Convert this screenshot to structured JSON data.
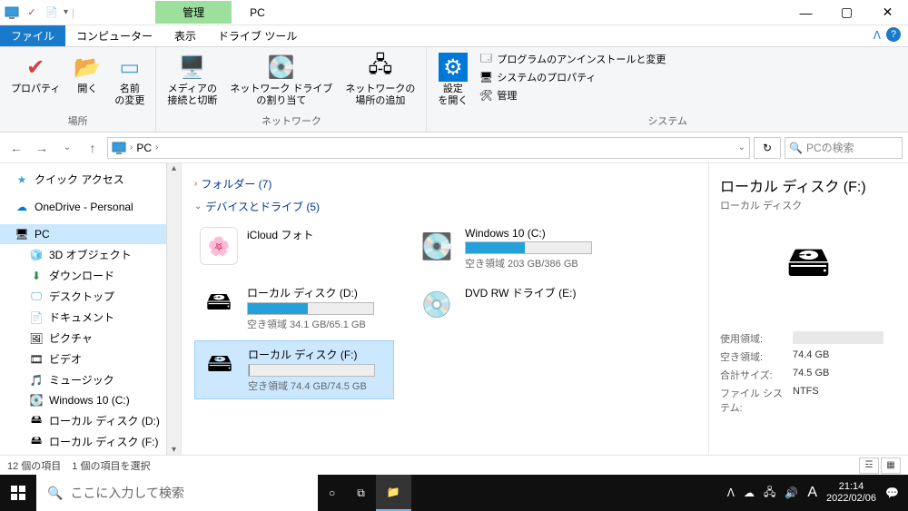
{
  "titlebar": {
    "contextual_tab": "管理",
    "title": "PC"
  },
  "ribbon_tabs": {
    "file": "ファイル",
    "computer": "コンピューター",
    "view": "表示",
    "drive_tools": "ドライブ ツール"
  },
  "ribbon": {
    "location": {
      "properties": "プロパティ",
      "open": "開く",
      "rename": "名前\nの変更",
      "group": "場所"
    },
    "network": {
      "media": "メディアの\n接続と切断",
      "map_drive": "ネットワーク ドライブ\nの割り当て",
      "add_location": "ネットワークの\n場所の追加",
      "group": "ネットワーク"
    },
    "system": {
      "settings": "設定\nを開く",
      "uninstall": "プログラムのアンインストールと変更",
      "sys_props": "システムのプロパティ",
      "manage": "管理",
      "group": "システム"
    }
  },
  "breadcrumb": {
    "root": "PC",
    "sep": "›"
  },
  "search": {
    "placeholder": "PCの検索"
  },
  "nav": {
    "quick_access": "クイック アクセス",
    "onedrive": "OneDrive - Personal",
    "pc": "PC",
    "objects3d": "3D オブジェクト",
    "downloads": "ダウンロード",
    "desktop": "デスクトップ",
    "documents": "ドキュメント",
    "pictures": "ピクチャ",
    "videos": "ビデオ",
    "music": "ミュージック",
    "drive_c": "Windows 10 (C:)",
    "drive_d": "ローカル ディスク (D:)",
    "drive_f": "ローカル ディスク (F:)"
  },
  "content": {
    "folders_hdr": "フォルダー (7)",
    "devices_hdr": "デバイスとドライブ (5)",
    "drives": {
      "icloud": {
        "name": "iCloud フォト"
      },
      "c": {
        "name": "Windows 10 (C:)",
        "free": "空き領域 203 GB/386 GB",
        "pct": 47
      },
      "d": {
        "name": "ローカル ディスク (D:)",
        "free": "空き領域 34.1 GB/65.1 GB",
        "pct": 48
      },
      "e": {
        "name": "DVD RW ドライブ (E:)"
      },
      "f": {
        "name": "ローカル ディスク (F:)",
        "free": "空き領域 74.4 GB/74.5 GB",
        "pct": 1
      }
    }
  },
  "details": {
    "title": "ローカル ディスク (F:)",
    "subtitle": "ローカル ディスク",
    "used_k": "使用領域:",
    "free_k": "空き領域:",
    "free_v": "74.4 GB",
    "total_k": "合計サイズ:",
    "total_v": "74.5 GB",
    "fs_k": "ファイル システム:",
    "fs_v": "NTFS"
  },
  "status": {
    "count": "12 個の項目",
    "selected": "1 個の項目を選択"
  },
  "taskbar": {
    "search": "ここに入力して検索",
    "time": "21:14",
    "date": "2022/02/06",
    "ime": "A"
  }
}
